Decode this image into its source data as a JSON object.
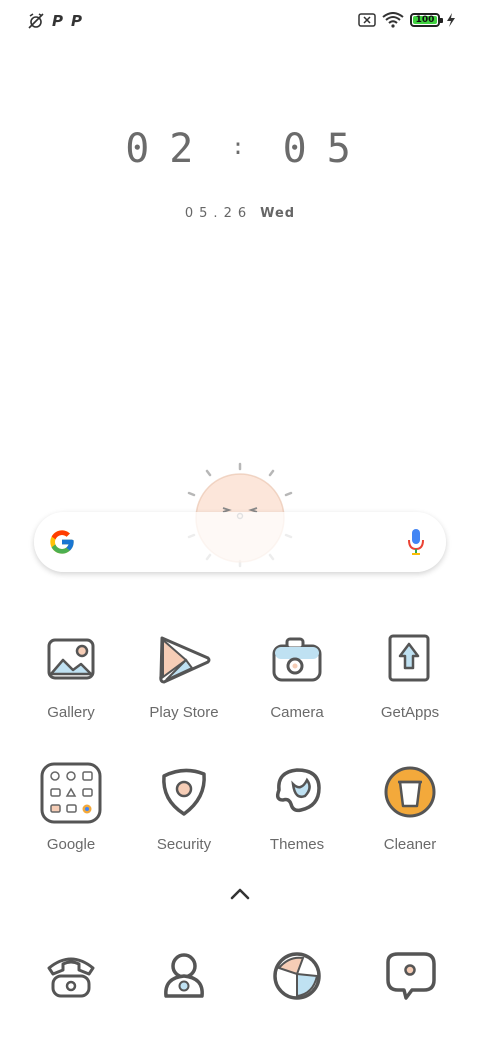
{
  "status_bar": {
    "left_icons": [
      "alarm-off-icon",
      "p-icon",
      "p-icon"
    ],
    "p_glyph": "P",
    "battery_level": "100",
    "right_icons": [
      "sim-off-icon",
      "wifi-icon",
      "battery-icon",
      "charging-icon"
    ]
  },
  "clock": {
    "h1": "0",
    "h2": "2",
    "sep": ":",
    "m1": "0",
    "m2": "5"
  },
  "date": {
    "day": "05.26",
    "weekday": "Wed"
  },
  "search": {
    "mic": "mic-icon"
  },
  "apps_row1": [
    {
      "label": "Gallery",
      "icon": "gallery-icon"
    },
    {
      "label": "Play Store",
      "icon": "play-store-icon"
    },
    {
      "label": "Camera",
      "icon": "camera-icon"
    },
    {
      "label": "GetApps",
      "icon": "getapps-icon"
    }
  ],
  "apps_row2": [
    {
      "label": "Google",
      "icon": "google-folder-icon"
    },
    {
      "label": "Security",
      "icon": "security-icon"
    },
    {
      "label": "Themes",
      "icon": "themes-icon"
    },
    {
      "label": "Cleaner",
      "icon": "cleaner-icon"
    }
  ],
  "dock": [
    "phone-icon",
    "contacts-icon",
    "browser-icon",
    "messages-icon"
  ],
  "colors": {
    "accent_blue": "#bfe1f2",
    "accent_peach": "#f6cdb6",
    "cleaner_orange": "#f3a93b",
    "outline": "#555555",
    "battery_green": "#3fd13f"
  }
}
